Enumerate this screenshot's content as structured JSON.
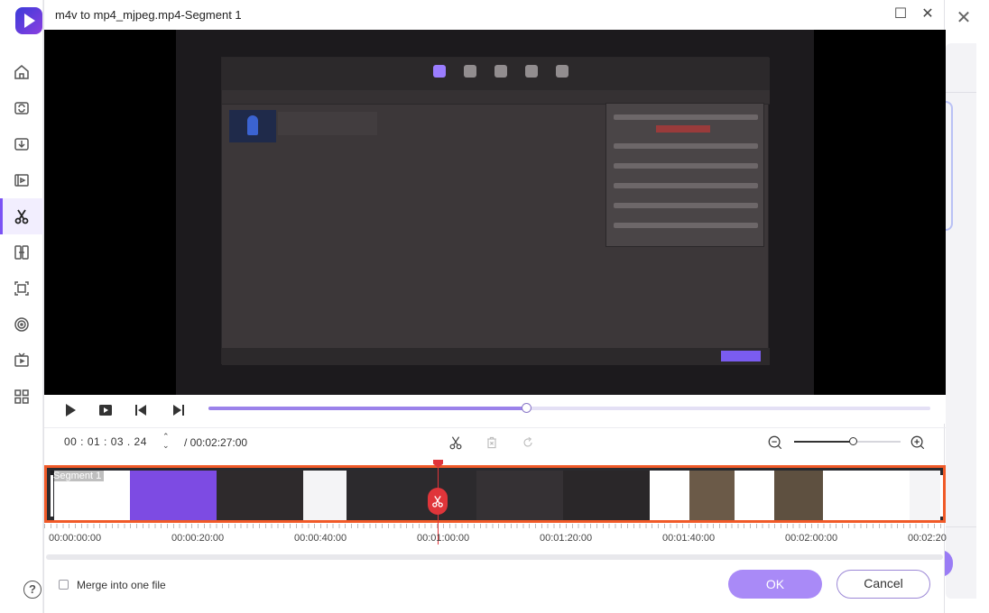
{
  "dialog": {
    "title": "m4v to mp4_mjpeg.mp4-Segment 1",
    "maximize_glyph": "☐",
    "close_glyph": "✕"
  },
  "background": {
    "close_glyph": "✕"
  },
  "sidebar": {
    "items": [
      {
        "name": "home-icon"
      },
      {
        "name": "convert-icon"
      },
      {
        "name": "download-icon"
      },
      {
        "name": "video-editor-icon"
      },
      {
        "name": "cut-icon",
        "active": true
      },
      {
        "name": "merge-icon"
      },
      {
        "name": "screen-record-icon"
      },
      {
        "name": "dvd-burn-icon"
      },
      {
        "name": "tv-icon"
      },
      {
        "name": "toolbox-icon"
      }
    ],
    "help_glyph": "?"
  },
  "player": {
    "progress": 0.44
  },
  "time": {
    "current": "00 : 01 : 03 . 24",
    "total": "/ 00:02:27:00",
    "stepper_up": "⌃",
    "stepper_down": "⌄"
  },
  "zoom": {
    "level": 0.55
  },
  "timeline": {
    "segment_label": "Segment 1",
    "playhead_fraction": 0.44,
    "ruler_labels": [
      "00:00:00:00",
      "00:00:20:00",
      "00:00:40:00",
      "00:01:00:00",
      "00:01:20:00",
      "00:01:40:00",
      "00:02:00:00",
      "00:02:20"
    ]
  },
  "footer": {
    "merge_label": "Merge into one file",
    "ok_label": "OK",
    "cancel_label": "Cancel"
  },
  "colors": {
    "accent": "#7b52f4",
    "segment_border": "#f05a28",
    "playhead": "#e0353a",
    "ok_button": "#a98af7"
  }
}
